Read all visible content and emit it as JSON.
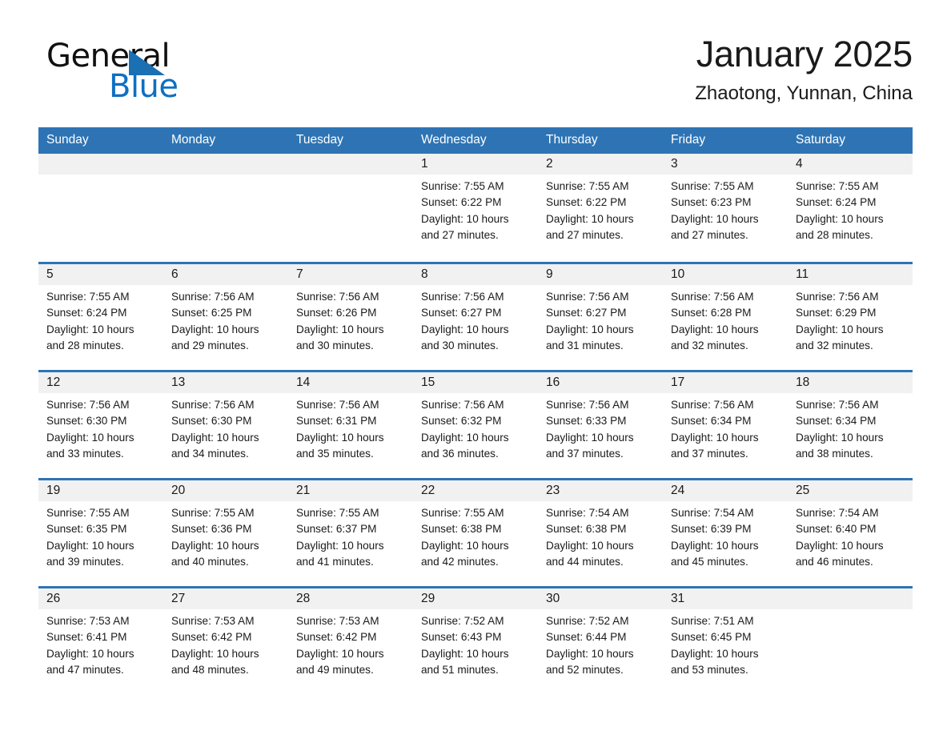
{
  "brand": {
    "name_part1": "General",
    "name_part2": "Blue",
    "triangle_icon": "brand-triangle-icon",
    "color_blue": "#0f6fc2",
    "color_black": "#101010"
  },
  "header": {
    "title": "January 2025",
    "subtitle": "Zhaotong, Yunnan, China"
  },
  "theme": {
    "header_bg": "#2e74b5",
    "header_text": "#ffffff",
    "daynum_band_bg": "#f1f1f1",
    "cell_separator": "#2e74b5",
    "body_text": "#1a1a1a"
  },
  "weekday_headers": [
    "Sunday",
    "Monday",
    "Tuesday",
    "Wednesday",
    "Thursday",
    "Friday",
    "Saturday"
  ],
  "labels": {
    "sunrise_prefix": "Sunrise:",
    "sunset_prefix": "Sunset:",
    "daylight_prefix": "Daylight:"
  },
  "weeks": [
    [
      {
        "day": "",
        "line1": "",
        "line2": "",
        "line3": "",
        "line4": "",
        "empty": true
      },
      {
        "day": "",
        "line1": "",
        "line2": "",
        "line3": "",
        "line4": "",
        "empty": true
      },
      {
        "day": "",
        "line1": "",
        "line2": "",
        "line3": "",
        "line4": "",
        "empty": true
      },
      {
        "day": "1",
        "line1": "Sunrise: 7:55 AM",
        "line2": "Sunset: 6:22 PM",
        "line3": "Daylight: 10 hours",
        "line4": "and 27 minutes.",
        "empty": false
      },
      {
        "day": "2",
        "line1": "Sunrise: 7:55 AM",
        "line2": "Sunset: 6:22 PM",
        "line3": "Daylight: 10 hours",
        "line4": "and 27 minutes.",
        "empty": false
      },
      {
        "day": "3",
        "line1": "Sunrise: 7:55 AM",
        "line2": "Sunset: 6:23 PM",
        "line3": "Daylight: 10 hours",
        "line4": "and 27 minutes.",
        "empty": false
      },
      {
        "day": "4",
        "line1": "Sunrise: 7:55 AM",
        "line2": "Sunset: 6:24 PM",
        "line3": "Daylight: 10 hours",
        "line4": "and 28 minutes.",
        "empty": false
      }
    ],
    [
      {
        "day": "5",
        "line1": "Sunrise: 7:55 AM",
        "line2": "Sunset: 6:24 PM",
        "line3": "Daylight: 10 hours",
        "line4": "and 28 minutes.",
        "empty": false
      },
      {
        "day": "6",
        "line1": "Sunrise: 7:56 AM",
        "line2": "Sunset: 6:25 PM",
        "line3": "Daylight: 10 hours",
        "line4": "and 29 minutes.",
        "empty": false
      },
      {
        "day": "7",
        "line1": "Sunrise: 7:56 AM",
        "line2": "Sunset: 6:26 PM",
        "line3": "Daylight: 10 hours",
        "line4": "and 30 minutes.",
        "empty": false
      },
      {
        "day": "8",
        "line1": "Sunrise: 7:56 AM",
        "line2": "Sunset: 6:27 PM",
        "line3": "Daylight: 10 hours",
        "line4": "and 30 minutes.",
        "empty": false
      },
      {
        "day": "9",
        "line1": "Sunrise: 7:56 AM",
        "line2": "Sunset: 6:27 PM",
        "line3": "Daylight: 10 hours",
        "line4": "and 31 minutes.",
        "empty": false
      },
      {
        "day": "10",
        "line1": "Sunrise: 7:56 AM",
        "line2": "Sunset: 6:28 PM",
        "line3": "Daylight: 10 hours",
        "line4": "and 32 minutes.",
        "empty": false
      },
      {
        "day": "11",
        "line1": "Sunrise: 7:56 AM",
        "line2": "Sunset: 6:29 PM",
        "line3": "Daylight: 10 hours",
        "line4": "and 32 minutes.",
        "empty": false
      }
    ],
    [
      {
        "day": "12",
        "line1": "Sunrise: 7:56 AM",
        "line2": "Sunset: 6:30 PM",
        "line3": "Daylight: 10 hours",
        "line4": "and 33 minutes.",
        "empty": false
      },
      {
        "day": "13",
        "line1": "Sunrise: 7:56 AM",
        "line2": "Sunset: 6:30 PM",
        "line3": "Daylight: 10 hours",
        "line4": "and 34 minutes.",
        "empty": false
      },
      {
        "day": "14",
        "line1": "Sunrise: 7:56 AM",
        "line2": "Sunset: 6:31 PM",
        "line3": "Daylight: 10 hours",
        "line4": "and 35 minutes.",
        "empty": false
      },
      {
        "day": "15",
        "line1": "Sunrise: 7:56 AM",
        "line2": "Sunset: 6:32 PM",
        "line3": "Daylight: 10 hours",
        "line4": "and 36 minutes.",
        "empty": false
      },
      {
        "day": "16",
        "line1": "Sunrise: 7:56 AM",
        "line2": "Sunset: 6:33 PM",
        "line3": "Daylight: 10 hours",
        "line4": "and 37 minutes.",
        "empty": false
      },
      {
        "day": "17",
        "line1": "Sunrise: 7:56 AM",
        "line2": "Sunset: 6:34 PM",
        "line3": "Daylight: 10 hours",
        "line4": "and 37 minutes.",
        "empty": false
      },
      {
        "day": "18",
        "line1": "Sunrise: 7:56 AM",
        "line2": "Sunset: 6:34 PM",
        "line3": "Daylight: 10 hours",
        "line4": "and 38 minutes.",
        "empty": false
      }
    ],
    [
      {
        "day": "19",
        "line1": "Sunrise: 7:55 AM",
        "line2": "Sunset: 6:35 PM",
        "line3": "Daylight: 10 hours",
        "line4": "and 39 minutes.",
        "empty": false
      },
      {
        "day": "20",
        "line1": "Sunrise: 7:55 AM",
        "line2": "Sunset: 6:36 PM",
        "line3": "Daylight: 10 hours",
        "line4": "and 40 minutes.",
        "empty": false
      },
      {
        "day": "21",
        "line1": "Sunrise: 7:55 AM",
        "line2": "Sunset: 6:37 PM",
        "line3": "Daylight: 10 hours",
        "line4": "and 41 minutes.",
        "empty": false
      },
      {
        "day": "22",
        "line1": "Sunrise: 7:55 AM",
        "line2": "Sunset: 6:38 PM",
        "line3": "Daylight: 10 hours",
        "line4": "and 42 minutes.",
        "empty": false
      },
      {
        "day": "23",
        "line1": "Sunrise: 7:54 AM",
        "line2": "Sunset: 6:38 PM",
        "line3": "Daylight: 10 hours",
        "line4": "and 44 minutes.",
        "empty": false
      },
      {
        "day": "24",
        "line1": "Sunrise: 7:54 AM",
        "line2": "Sunset: 6:39 PM",
        "line3": "Daylight: 10 hours",
        "line4": "and 45 minutes.",
        "empty": false
      },
      {
        "day": "25",
        "line1": "Sunrise: 7:54 AM",
        "line2": "Sunset: 6:40 PM",
        "line3": "Daylight: 10 hours",
        "line4": "and 46 minutes.",
        "empty": false
      }
    ],
    [
      {
        "day": "26",
        "line1": "Sunrise: 7:53 AM",
        "line2": "Sunset: 6:41 PM",
        "line3": "Daylight: 10 hours",
        "line4": "and 47 minutes.",
        "empty": false
      },
      {
        "day": "27",
        "line1": "Sunrise: 7:53 AM",
        "line2": "Sunset: 6:42 PM",
        "line3": "Daylight: 10 hours",
        "line4": "and 48 minutes.",
        "empty": false
      },
      {
        "day": "28",
        "line1": "Sunrise: 7:53 AM",
        "line2": "Sunset: 6:42 PM",
        "line3": "Daylight: 10 hours",
        "line4": "and 49 minutes.",
        "empty": false
      },
      {
        "day": "29",
        "line1": "Sunrise: 7:52 AM",
        "line2": "Sunset: 6:43 PM",
        "line3": "Daylight: 10 hours",
        "line4": "and 51 minutes.",
        "empty": false
      },
      {
        "day": "30",
        "line1": "Sunrise: 7:52 AM",
        "line2": "Sunset: 6:44 PM",
        "line3": "Daylight: 10 hours",
        "line4": "and 52 minutes.",
        "empty": false
      },
      {
        "day": "31",
        "line1": "Sunrise: 7:51 AM",
        "line2": "Sunset: 6:45 PM",
        "line3": "Daylight: 10 hours",
        "line4": "and 53 minutes.",
        "empty": false
      },
      {
        "day": "",
        "line1": "",
        "line2": "",
        "line3": "",
        "line4": "",
        "empty": true
      }
    ]
  ]
}
